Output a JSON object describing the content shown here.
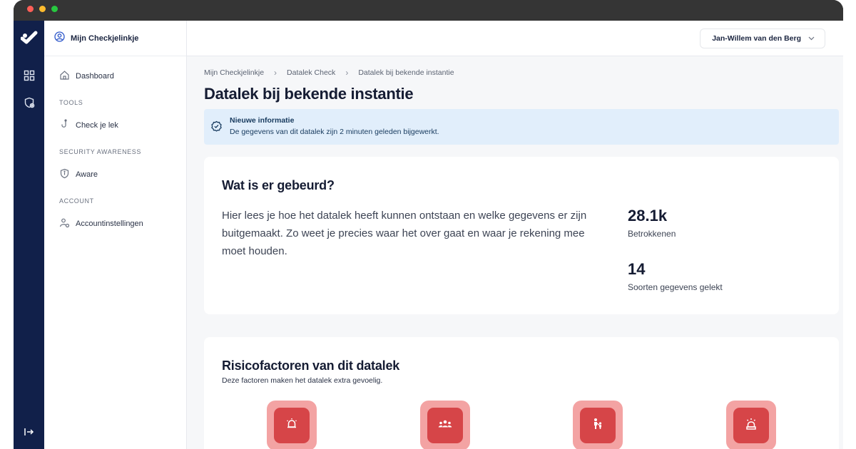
{
  "window": {
    "controls": [
      "close",
      "minimize",
      "zoom"
    ]
  },
  "rail": {
    "logo_icon": "checkmark-logo-icon",
    "items": [
      {
        "icon": "dashboard-grid-icon"
      },
      {
        "icon": "shield-gear-icon"
      }
    ],
    "collapse_icon": "collapse-arrow-icon"
  },
  "sidebar": {
    "header": "Mijn Checkjelinkje",
    "dashboard": "Dashboard",
    "sections": {
      "tools": "TOOLS",
      "security": "SECURITY AWARENESS",
      "account": "ACCOUNT"
    },
    "items": {
      "check": "Check je lek",
      "aware": "Aware",
      "account": "Accountinstellingen"
    }
  },
  "topbar": {
    "user": "Jan-Willem van den Berg"
  },
  "breadcrumb": [
    "Mijn Checkjelinkje",
    "Datalek Check",
    "Datalek bij bekende instantie"
  ],
  "page_title": "Datalek bij bekende instantie",
  "alert": {
    "title": "Nieuwe informatie",
    "text": "De gegevens van dit datalek zijn 2 minuten geleden bijgewerkt."
  },
  "what_happened": {
    "title": "Wat is er gebeurd?",
    "description": "Hier lees je hoe het datalek heeft kunnen ontstaan en welke gegevens er zijn buitgemaakt. Zo weet je precies waar het over gaat en waar je rekening mee moet houden.",
    "stats": [
      {
        "value": "28.1k",
        "label": "Betrokkenen"
      },
      {
        "value": "14",
        "label": "Soorten gegevens gelekt"
      }
    ]
  },
  "risk": {
    "title": "Risicofactoren van dit datalek",
    "subtitle": "Deze factoren maken het datalek extra gevoelig.",
    "icons": [
      "alarm-bell-icon",
      "people-group-icon",
      "parent-child-icon",
      "siren-icon"
    ]
  },
  "colors": {
    "rail": "#11204a",
    "alert_bg": "#e1eefb",
    "risk_outer": "#f3a3a3",
    "risk_inner": "#d64548"
  }
}
